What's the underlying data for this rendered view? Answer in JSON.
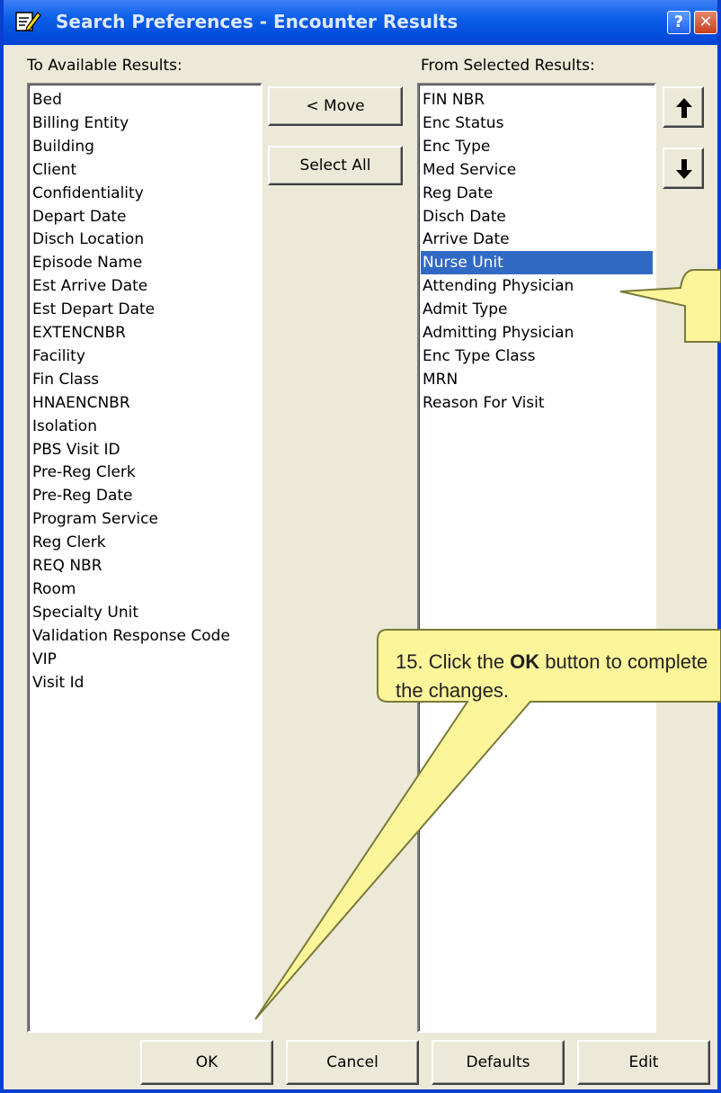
{
  "window": {
    "title": "Search Preferences - Encounter Results",
    "help_label": "?",
    "close_label": "✕"
  },
  "available": {
    "label": "To Available Results:",
    "items": [
      "Bed",
      "Billing Entity",
      "Building",
      "Client",
      "Confidentiality",
      "Depart Date",
      "Disch Location",
      "Episode Name",
      "Est Arrive Date",
      "Est Depart Date",
      "EXTENCNBR",
      "Facility",
      "Fin Class",
      "HNAENCNBR",
      "Isolation",
      "PBS Visit ID",
      "Pre-Reg Clerk",
      "Pre-Reg Date",
      "Program Service",
      "Reg Clerk",
      "REQ NBR",
      "Room",
      "Specialty Unit",
      "Validation Response Code",
      "VIP",
      "Visit Id"
    ]
  },
  "selected": {
    "label": "From Selected Results:",
    "items": [
      "FIN NBR",
      "Enc Status",
      "Enc Type",
      "Med Service",
      "Reg Date",
      "Disch Date",
      "Arrive Date",
      "Nurse Unit",
      "Attending Physician",
      "Admit Type",
      "Admitting Physician",
      "Enc Type Class",
      "MRN",
      "Reason For Visit"
    ],
    "selected_item": "Nurse Unit"
  },
  "buttons": {
    "move": "< Move",
    "select_all": "Select All",
    "ok": "OK",
    "cancel": "Cancel",
    "defaults": "Defaults",
    "edit": "Edit"
  },
  "icons": {
    "up": "arrow-up-icon",
    "down": "arrow-down-icon"
  },
  "callout": {
    "text_before": "15. Click the ",
    "text_bold": "OK",
    "text_after": " button to complete the changes."
  },
  "colors": {
    "selection": "#316ac5",
    "titlebar": "#0a5fe8",
    "callout_fill": "#fdf59a"
  }
}
